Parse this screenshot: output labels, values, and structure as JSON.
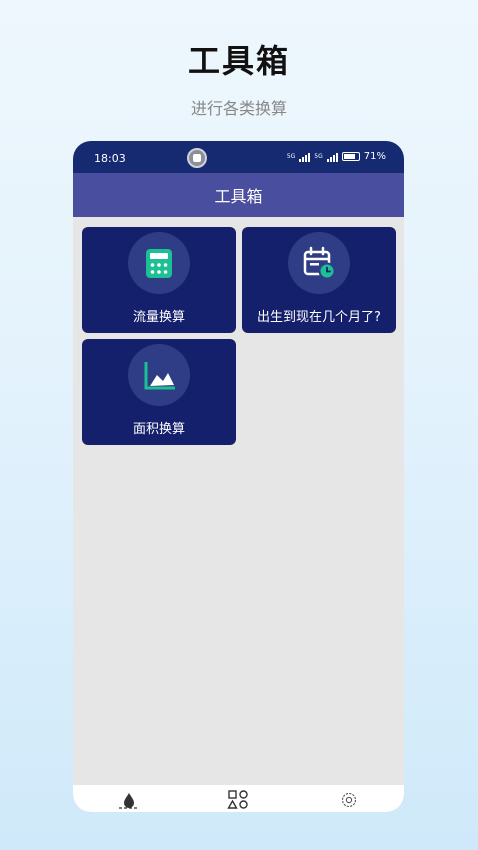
{
  "promo": {
    "title": "工具箱",
    "subtitle": "进行各类换算"
  },
  "status_bar": {
    "time": "18:03",
    "battery": "71%",
    "network_1": "5G",
    "network_2": "5G"
  },
  "app_bar": {
    "title": "工具箱"
  },
  "tools": [
    {
      "label": "流量换算",
      "icon": "calculator-icon"
    },
    {
      "label": "出生到现在几个月了?",
      "icon": "calendar-clock-icon"
    },
    {
      "label": "面积换算",
      "icon": "area-chart-icon"
    }
  ],
  "bottom_nav": [
    {
      "icon": "water-drop-icon"
    },
    {
      "icon": "apps-grid-icon"
    },
    {
      "icon": "settings-gear-icon"
    }
  ],
  "colors": {
    "status_bar": "#162a72",
    "app_bar": "#4a4e9e",
    "card": "#14206b",
    "card_icon_circle": "#2f3c86",
    "accent": "#1dbf94"
  }
}
